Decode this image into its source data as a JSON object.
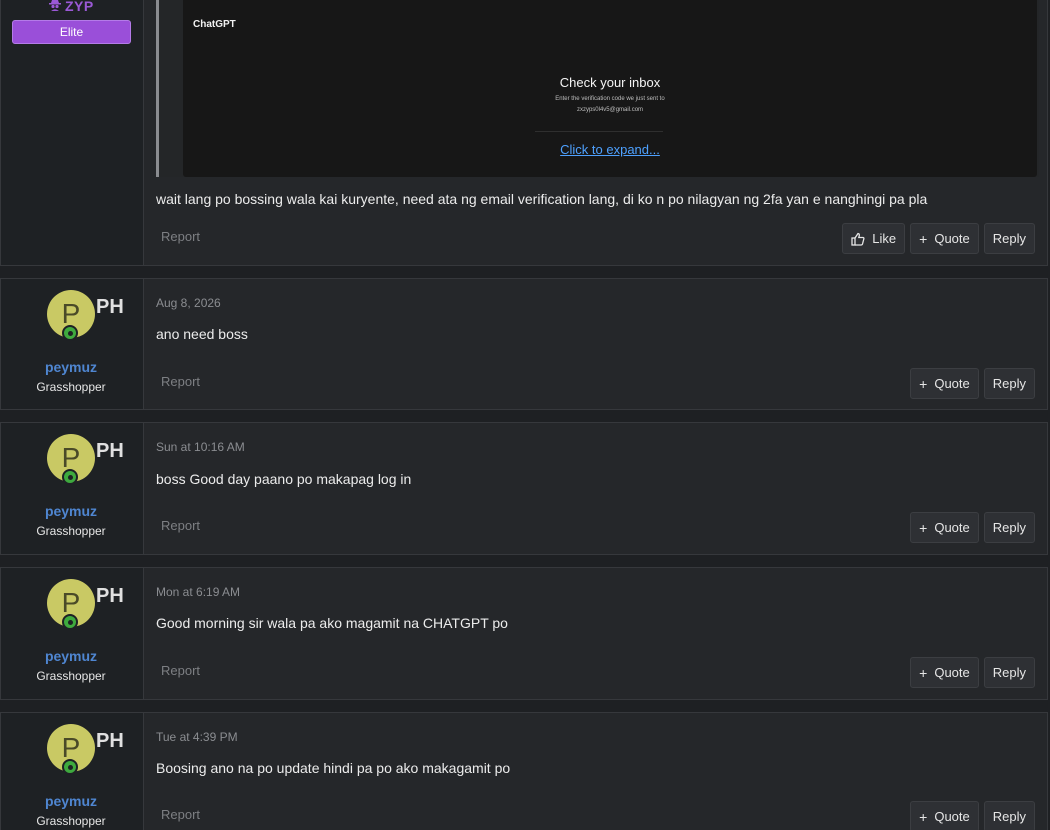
{
  "post0": {
    "username": "ZYP",
    "badge": "Elite",
    "screenshot": {
      "brand": "ChatGPT",
      "title": "Check your inbox",
      "subtitle": "Enter the verification code we just sent to",
      "email": "zxzyps0l4v5@gmail.com"
    },
    "expand_link": "Click to expand...",
    "message": "wait lang po bossing wala kai kuryente, need ata ng email verification lang, di ko n po nilagyan ng 2fa yan e nanghingi pa pla",
    "report": "Report",
    "like": "Like",
    "quote": "Quote",
    "reply": "Reply"
  },
  "posts": [
    {
      "avatar_letter": "P",
      "flag": "PH",
      "username": "peymuz",
      "user_title": "Grasshopper",
      "date": "Aug 8, 2026",
      "message": "ano need boss",
      "report": "Report",
      "quote": "Quote",
      "reply": "Reply"
    },
    {
      "avatar_letter": "P",
      "flag": "PH",
      "username": "peymuz",
      "user_title": "Grasshopper",
      "date": "Sun at 10:16 AM",
      "message": "boss Good day paano po makapag log in",
      "report": "Report",
      "quote": "Quote",
      "reply": "Reply"
    },
    {
      "avatar_letter": "P",
      "flag": "PH",
      "username": "peymuz",
      "user_title": "Grasshopper",
      "date": "Mon at 6:19 AM",
      "message": "Good morning sir wala pa ako magamit na CHATGPT po",
      "report": "Report",
      "quote": "Quote",
      "reply": "Reply"
    },
    {
      "avatar_letter": "P",
      "flag": "PH",
      "username": "peymuz",
      "user_title": "Grasshopper",
      "date": "Tue at 4:39 PM",
      "message": "Boosing ano na po update hindi pa po ako makagamit po",
      "report": "Report",
      "quote": "Quote",
      "reply": "Reply"
    }
  ],
  "icons": {
    "spy": "spy-icon",
    "like": "thumbs-up-icon",
    "quote": "plus-icon",
    "online": "online-status-icon"
  },
  "colors": {
    "elite": "#9a4fd9",
    "username": "#4f86d1",
    "link": "#4ea1ff",
    "avatar": "#c9c964",
    "online": "#3eaa3e"
  }
}
